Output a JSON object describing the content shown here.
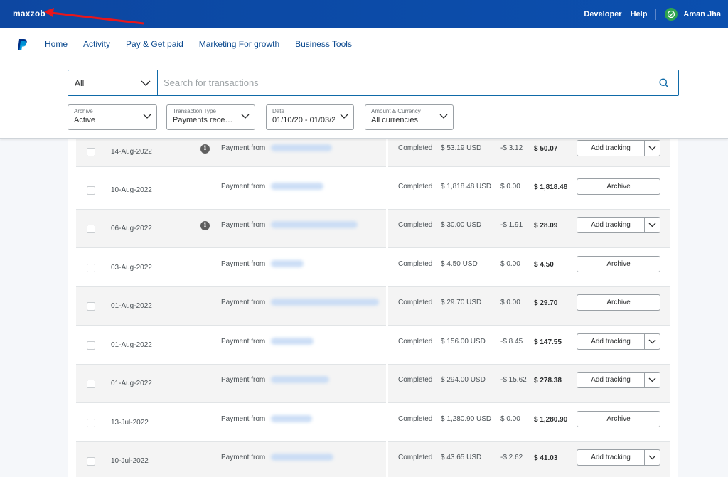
{
  "topbar": {
    "brand": "maxzob",
    "links": [
      "Developer",
      "Help"
    ],
    "user": "Aman Jha"
  },
  "nav": {
    "items": [
      "Home",
      "Activity",
      "Pay & Get paid",
      "Marketing For growth",
      "Business Tools"
    ]
  },
  "search": {
    "scope": "All",
    "placeholder": "Search for transactions"
  },
  "filters": [
    {
      "label": "Archive",
      "value": "Active"
    },
    {
      "label": "Transaction Type",
      "value": "Payments rece…"
    },
    {
      "label": "Date",
      "value": "01/10/20 - 01/03/2"
    },
    {
      "label": "Amount & Currency",
      "value": "All currencies"
    }
  ],
  "rows": [
    {
      "date": "14-Aug-2022",
      "info": true,
      "type": "Payment from",
      "status": "Completed",
      "gross": "$ 53.19 USD",
      "fee": "-$ 3.12",
      "net": "$ 50.07",
      "action": "Add tracking",
      "split": true
    },
    {
      "date": "10-Aug-2022",
      "info": false,
      "type": "Payment from",
      "status": "Completed",
      "gross": "$ 1,818.48 USD",
      "fee": "$ 0.00",
      "net": "$ 1,818.48",
      "action": "Archive",
      "split": false
    },
    {
      "date": "06-Aug-2022",
      "info": true,
      "type": "Payment from",
      "status": "Completed",
      "gross": "$ 30.00 USD",
      "fee": "-$ 1.91",
      "net": "$ 28.09",
      "action": "Add tracking",
      "split": true
    },
    {
      "date": "03-Aug-2022",
      "info": false,
      "type": "Payment from",
      "status": "Completed",
      "gross": "$ 4.50 USD",
      "fee": "$ 0.00",
      "net": "$ 4.50",
      "action": "Archive",
      "split": false
    },
    {
      "date": "01-Aug-2022",
      "info": false,
      "type": "Payment from",
      "status": "Completed",
      "gross": "$ 29.70 USD",
      "fee": "$ 0.00",
      "net": "$ 29.70",
      "action": "Archive",
      "split": false
    },
    {
      "date": "01-Aug-2022",
      "info": false,
      "type": "Payment from",
      "status": "Completed",
      "gross": "$ 156.00 USD",
      "fee": "-$ 8.45",
      "net": "$ 147.55",
      "action": "Add tracking",
      "split": true
    },
    {
      "date": "01-Aug-2022",
      "info": false,
      "type": "Payment from",
      "status": "Completed",
      "gross": "$ 294.00 USD",
      "fee": "-$ 15.62",
      "net": "$ 278.38",
      "action": "Add tracking",
      "split": true
    },
    {
      "date": "13-Jul-2022",
      "info": false,
      "type": "Payment from",
      "status": "Completed",
      "gross": "$ 1,280.90 USD",
      "fee": "$ 0.00",
      "net": "$ 1,280.90",
      "action": "Archive",
      "split": false
    },
    {
      "date": "10-Jul-2022",
      "info": false,
      "type": "Payment from",
      "status": "Completed",
      "gross": "$ 43.65 USD",
      "fee": "-$ 2.62",
      "net": "$ 41.03",
      "action": "Add tracking",
      "split": true
    }
  ],
  "colors": {
    "topbar": "#0d47a1",
    "link": "#0c4a8f",
    "search_border": "#0f6aa8",
    "annotation_arrow": "#e8161b"
  }
}
